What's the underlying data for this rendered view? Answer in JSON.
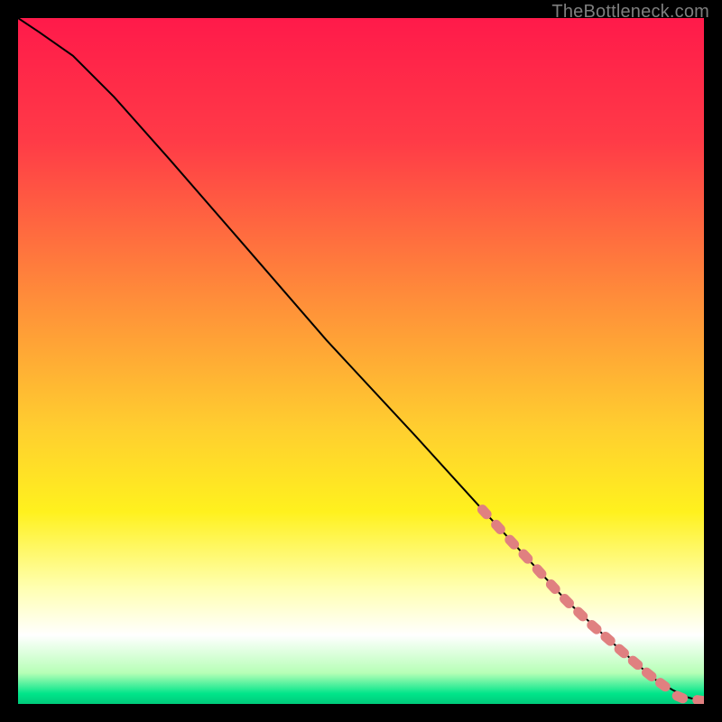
{
  "attribution": "TheBottleneck.com",
  "chart_data": {
    "type": "line",
    "title": "",
    "xlabel": "",
    "ylabel": "",
    "xlim": [
      0,
      100
    ],
    "ylim": [
      0,
      100
    ],
    "grid": false,
    "legend": null,
    "background_gradient": {
      "stops": [
        {
          "pos": 0.0,
          "color": "#ff1a4a"
        },
        {
          "pos": 0.18,
          "color": "#ff3b47"
        },
        {
          "pos": 0.4,
          "color": "#ff8a3a"
        },
        {
          "pos": 0.6,
          "color": "#ffcf2f"
        },
        {
          "pos": 0.72,
          "color": "#fff11e"
        },
        {
          "pos": 0.83,
          "color": "#ffffb0"
        },
        {
          "pos": 0.9,
          "color": "#ffffff"
        },
        {
          "pos": 0.955,
          "color": "#b6ffb6"
        },
        {
          "pos": 0.985,
          "color": "#00e58a"
        },
        {
          "pos": 1.0,
          "color": "#00c97a"
        }
      ]
    },
    "series": [
      {
        "name": "bottleneck-curve",
        "color": "#000000",
        "x": [
          0.0,
          3.0,
          8.0,
          14.0,
          22.0,
          32.0,
          45.0,
          58.0,
          68.0,
          74.0,
          80.0,
          86.0,
          90.0,
          93.0,
          95.5,
          97.5,
          99.0,
          100.0
        ],
        "y": [
          100.0,
          98.0,
          94.5,
          88.5,
          79.5,
          68.0,
          53.0,
          39.0,
          28.0,
          21.5,
          15.0,
          9.5,
          6.0,
          3.5,
          2.0,
          1.0,
          0.6,
          0.5
        ]
      }
    ],
    "markers": {
      "name": "highlighted-points",
      "color": "#e08080",
      "x": [
        68.0,
        70.0,
        72.0,
        74.0,
        76.0,
        78.0,
        80.0,
        82.0,
        84.0,
        86.0,
        88.0,
        90.0,
        92.0,
        94.0,
        96.5,
        99.5
      ],
      "y": [
        28.0,
        25.8,
        23.6,
        21.5,
        19.3,
        17.1,
        15.0,
        13.1,
        11.2,
        9.5,
        7.7,
        6.0,
        4.3,
        2.8,
        1.0,
        0.5
      ]
    }
  }
}
